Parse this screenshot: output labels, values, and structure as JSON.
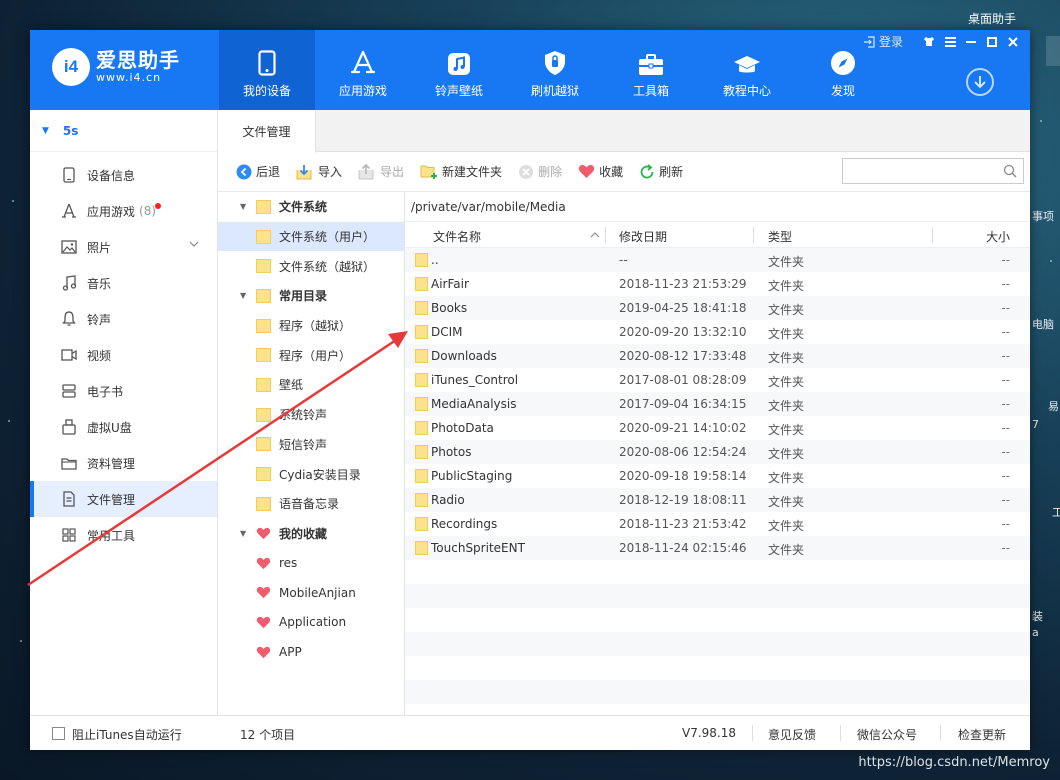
{
  "desktop": {
    "widget_title": "桌面助手",
    "side_labels": [
      "事项",
      "电脑",
      "易",
      "7",
      "工",
      "装",
      "a"
    ],
    "watermark": "https://blog.csdn.net/Memroy"
  },
  "app": {
    "logo": {
      "mark": "i4",
      "name": "爱思助手",
      "url": "www.i4.cn"
    },
    "nav": [
      {
        "label": "我的设备",
        "icon": "phone-icon"
      },
      {
        "label": "应用游戏",
        "icon": "app-store-icon"
      },
      {
        "label": "铃声壁纸",
        "icon": "music-note-icon"
      },
      {
        "label": "刷机越狱",
        "icon": "shield-icon"
      },
      {
        "label": "工具箱",
        "icon": "toolbox-icon"
      },
      {
        "label": "教程中心",
        "icon": "graduation-cap-icon"
      },
      {
        "label": "发现",
        "icon": "compass-icon"
      }
    ],
    "login_label": "登录",
    "accent": "#1877f2"
  },
  "sidebar": {
    "device": "5s",
    "items": [
      {
        "label": "设备信息",
        "icon": "phone-info-icon"
      },
      {
        "label": "应用游戏",
        "icon": "app-store-icon",
        "badge": "(8)"
      },
      {
        "label": "照片",
        "icon": "photo-icon"
      },
      {
        "label": "音乐",
        "icon": "music-note-icon"
      },
      {
        "label": "铃声",
        "icon": "bell-icon"
      },
      {
        "label": "视频",
        "icon": "video-icon"
      },
      {
        "label": "电子书",
        "icon": "book-icon"
      },
      {
        "label": "虚拟U盘",
        "icon": "usb-drive-icon"
      },
      {
        "label": "资料管理",
        "icon": "folder-icon"
      },
      {
        "label": "文件管理",
        "icon": "file-icon"
      },
      {
        "label": "常用工具",
        "icon": "grid-icon"
      }
    ]
  },
  "tab": {
    "label": "文件管理"
  },
  "toolbar": {
    "back": "后退",
    "import": "导入",
    "export": "导出",
    "new_folder": "新建文件夹",
    "delete": "删除",
    "favorite": "收藏",
    "refresh": "刷新",
    "search_placeholder": ""
  },
  "tree": {
    "groups": [
      {
        "label": "文件系统",
        "children": [
          "文件系统（用户）",
          "文件系统（越狱）"
        ]
      },
      {
        "label": "常用目录",
        "children": [
          "程序（越狱）",
          "程序（用户）",
          "壁纸",
          "系统铃声",
          "短信铃声",
          "Cydia安装目录",
          "语音备忘录"
        ]
      },
      {
        "label": "我的收藏",
        "children": [
          "res",
          "MobileAnjian",
          "Application",
          "APP"
        ]
      }
    ]
  },
  "list": {
    "path": "/private/var/mobile/Media",
    "columns": {
      "name": "文件名称",
      "date": "修改日期",
      "type": "类型",
      "size": "大小"
    },
    "rows": [
      {
        "name": "..",
        "date": "--",
        "type": "文件夹",
        "size": "--"
      },
      {
        "name": "AirFair",
        "date": "2018-11-23 21:53:29",
        "type": "文件夹",
        "size": "--"
      },
      {
        "name": "Books",
        "date": "2019-04-25 18:41:18",
        "type": "文件夹",
        "size": "--"
      },
      {
        "name": "DCIM",
        "date": "2020-09-20 13:32:10",
        "type": "文件夹",
        "size": "--"
      },
      {
        "name": "Downloads",
        "date": "2020-08-12 17:33:48",
        "type": "文件夹",
        "size": "--"
      },
      {
        "name": "iTunes_Control",
        "date": "2017-08-01 08:28:09",
        "type": "文件夹",
        "size": "--"
      },
      {
        "name": "MediaAnalysis",
        "date": "2017-09-04 16:34:15",
        "type": "文件夹",
        "size": "--"
      },
      {
        "name": "PhotoData",
        "date": "2020-09-21 14:10:02",
        "type": "文件夹",
        "size": "--"
      },
      {
        "name": "Photos",
        "date": "2020-08-06 12:54:24",
        "type": "文件夹",
        "size": "--"
      },
      {
        "name": "PublicStaging",
        "date": "2020-09-18 19:58:14",
        "type": "文件夹",
        "size": "--"
      },
      {
        "name": "Radio",
        "date": "2018-12-19 18:08:11",
        "type": "文件夹",
        "size": "--"
      },
      {
        "name": "Recordings",
        "date": "2018-11-23 21:53:42",
        "type": "文件夹",
        "size": "--"
      },
      {
        "name": "TouchSpriteENT",
        "date": "2018-11-24 02:15:46",
        "type": "文件夹",
        "size": "--"
      }
    ]
  },
  "status": {
    "block_itunes": "阻止iTunes自动运行",
    "count": "12 个项目",
    "version": "V7.98.18",
    "feedback": "意见反馈",
    "wechat": "微信公众号",
    "update": "检查更新"
  }
}
